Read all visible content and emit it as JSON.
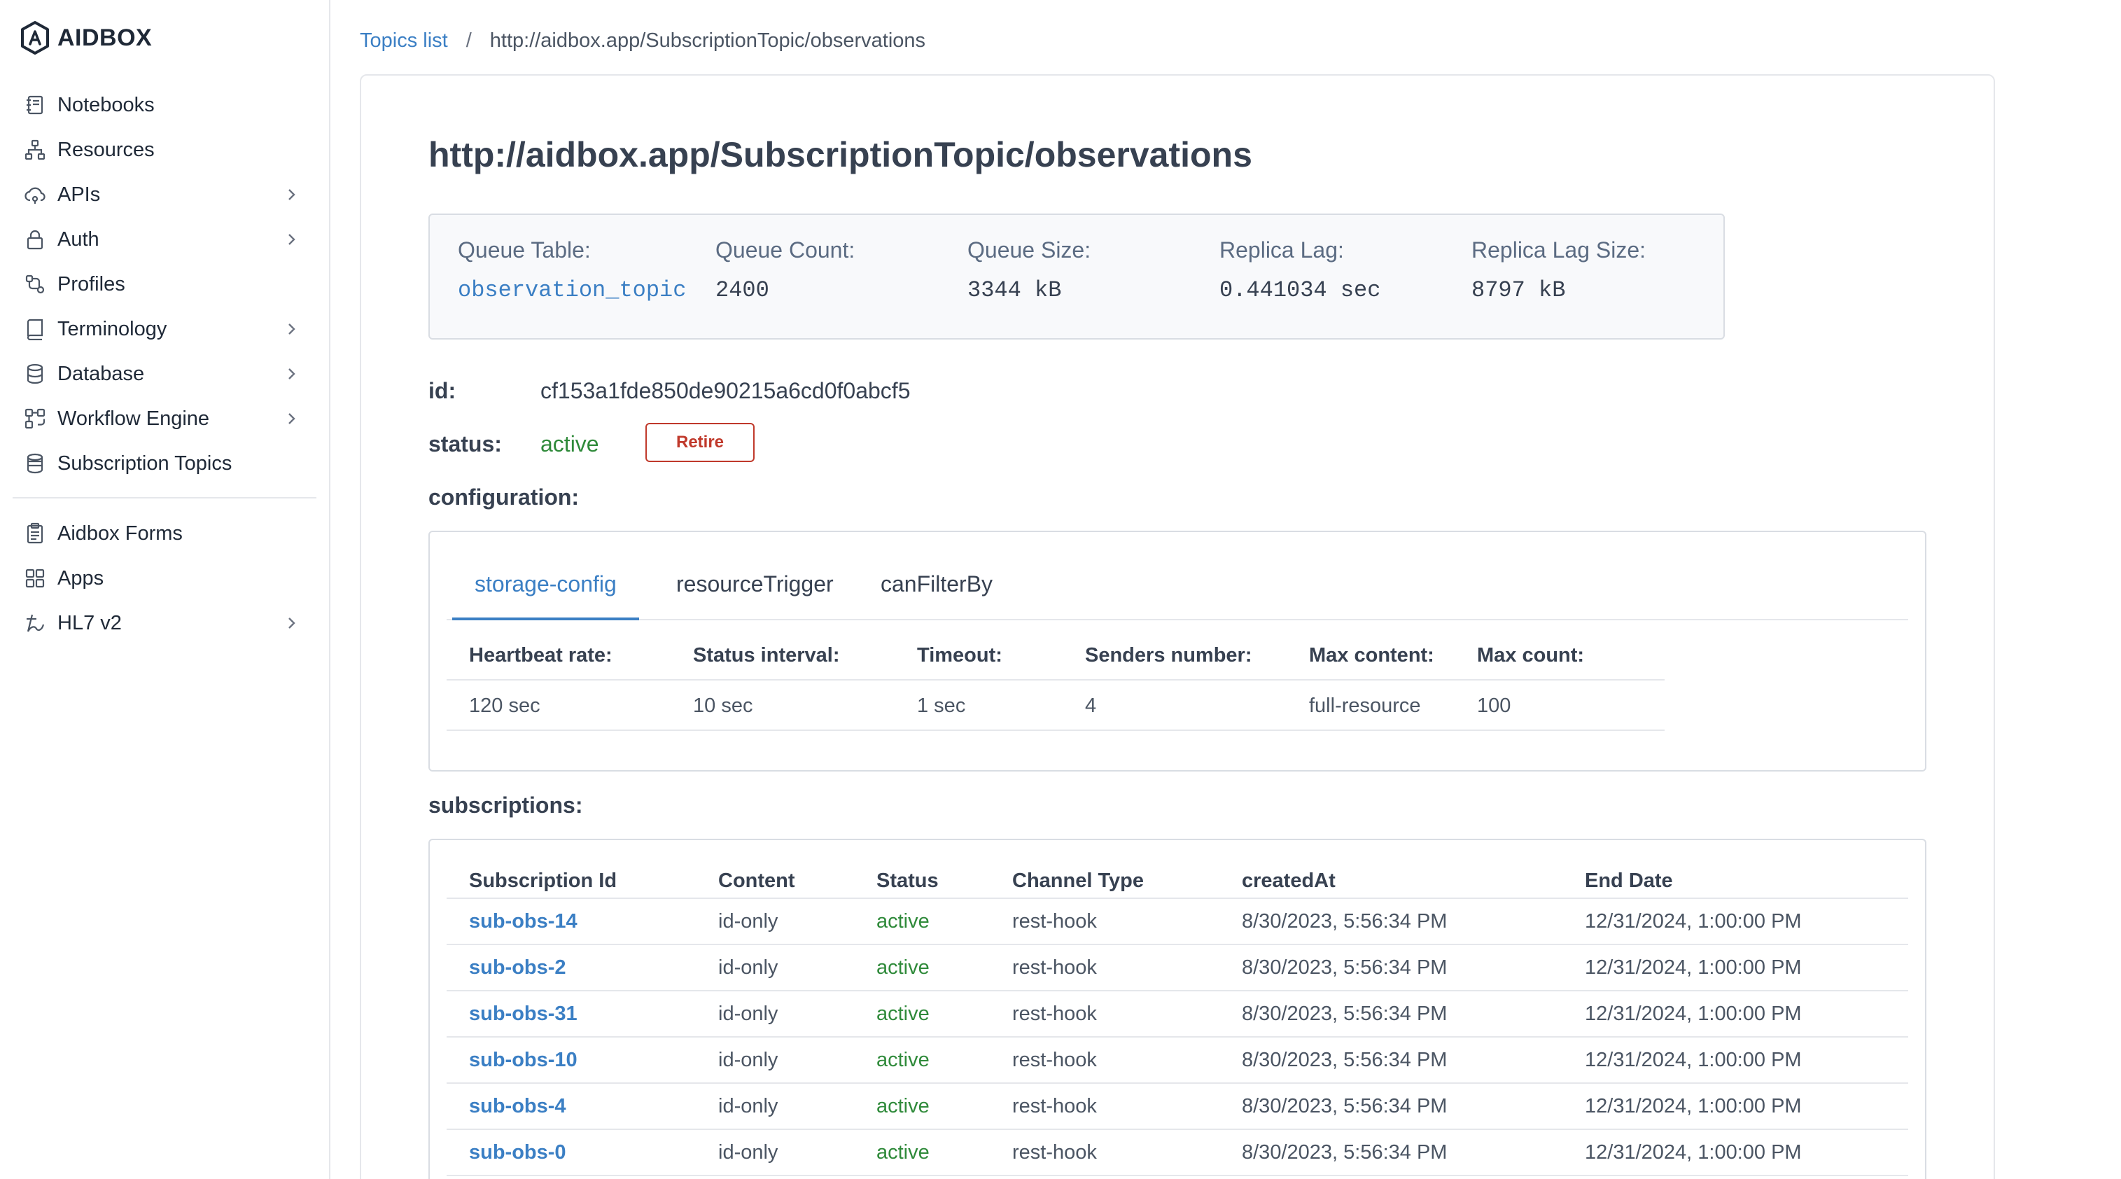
{
  "app": {
    "brand": "AIDBOX"
  },
  "sidebar": {
    "items": [
      {
        "label": "Notebooks",
        "icon": "notebook-icon",
        "has_children": false
      },
      {
        "label": "Resources",
        "icon": "resources-icon",
        "has_children": false
      },
      {
        "label": "APIs",
        "icon": "apis-icon",
        "has_children": true
      },
      {
        "label": "Auth",
        "icon": "lock-icon",
        "has_children": true
      },
      {
        "label": "Profiles",
        "icon": "profiles-icon",
        "has_children": false
      },
      {
        "label": "Terminology",
        "icon": "book-icon",
        "has_children": true
      },
      {
        "label": "Database",
        "icon": "database-icon",
        "has_children": true
      },
      {
        "label": "Workflow Engine",
        "icon": "workflow-icon",
        "has_children": true
      },
      {
        "label": "Subscription Topics",
        "icon": "subscription-icon",
        "has_children": false
      }
    ],
    "items2": [
      {
        "label": "Aidbox Forms",
        "icon": "clipboard-icon",
        "has_children": false
      },
      {
        "label": "Apps",
        "icon": "apps-icon",
        "has_children": false
      },
      {
        "label": "HL7 v2",
        "icon": "hl7-icon",
        "has_children": true
      }
    ]
  },
  "breadcrumb": {
    "link": "Topics list",
    "separator": "/",
    "current": "http://aidbox.app/SubscriptionTopic/observations"
  },
  "topic": {
    "title": "http://aidbox.app/SubscriptionTopic/observations",
    "queue": {
      "table_label": "Queue Table:",
      "table_value": "observation_topic",
      "count_label": "Queue Count:",
      "count_value": "2400",
      "size_label": "Queue Size:",
      "size_value": "3344 kB",
      "lag_label": "Replica Lag:",
      "lag_value": "0.441034 sec",
      "lag_size_label": "Replica Lag Size:",
      "lag_size_value": "8797 kB"
    },
    "id_label": "id:",
    "id_value": "cf153a1fde850de90215a6cd0f0abcf5",
    "status_label": "status:",
    "status_value": "active",
    "retire_label": "Retire",
    "configuration_label": "configuration:",
    "subscriptions_label": "subscriptions:"
  },
  "config": {
    "tabs": [
      "storage-config",
      "resourceTrigger",
      "canFilterBy"
    ],
    "active_tab": 0,
    "headers": [
      "Heartbeat rate:",
      "Status interval:",
      "Timeout:",
      "Senders number:",
      "Max content:",
      "Max count:"
    ],
    "values": [
      "120 sec",
      "10 sec",
      "1 sec",
      "4",
      "full-resource",
      "100"
    ]
  },
  "subscriptions": {
    "headers": [
      "Subscription Id",
      "Content",
      "Status",
      "Channel Type",
      "createdAt",
      "End Date"
    ],
    "rows": [
      [
        "sub-obs-14",
        "id-only",
        "active",
        "rest-hook",
        "8/30/2023, 5:56:34 PM",
        "12/31/2024, 1:00:00 PM"
      ],
      [
        "sub-obs-2",
        "id-only",
        "active",
        "rest-hook",
        "8/30/2023, 5:56:34 PM",
        "12/31/2024, 1:00:00 PM"
      ],
      [
        "sub-obs-31",
        "id-only",
        "active",
        "rest-hook",
        "8/30/2023, 5:56:34 PM",
        "12/31/2024, 1:00:00 PM"
      ],
      [
        "sub-obs-10",
        "id-only",
        "active",
        "rest-hook",
        "8/30/2023, 5:56:34 PM",
        "12/31/2024, 1:00:00 PM"
      ],
      [
        "sub-obs-4",
        "id-only",
        "active",
        "rest-hook",
        "8/30/2023, 5:56:34 PM",
        "12/31/2024, 1:00:00 PM"
      ],
      [
        "sub-obs-0",
        "id-only",
        "active",
        "rest-hook",
        "8/30/2023, 5:56:34 PM",
        "12/31/2024, 1:00:00 PM"
      ]
    ]
  },
  "colors": {
    "link": "#3b7fc4",
    "active": "#2f8a3a",
    "danger": "#c0392b"
  }
}
